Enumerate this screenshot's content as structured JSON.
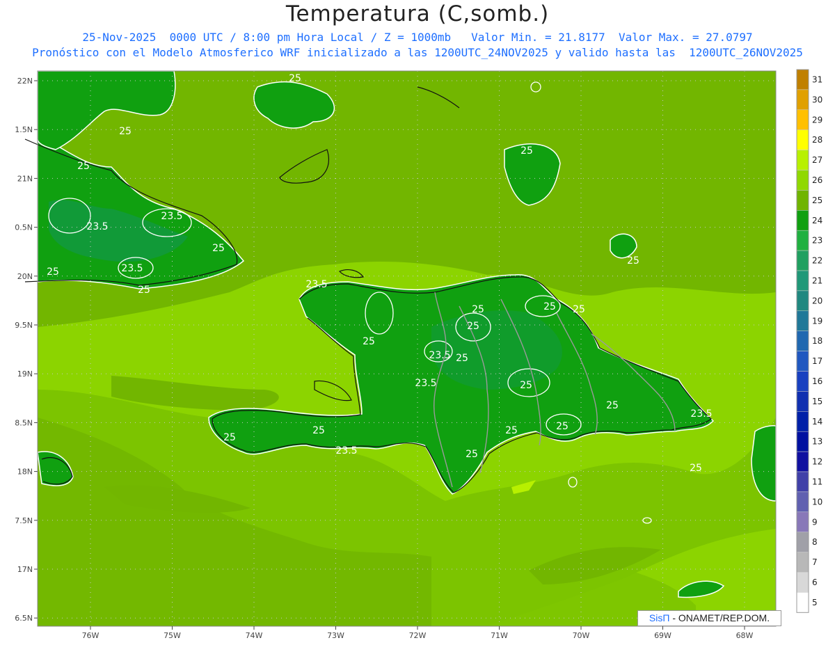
{
  "title": "Temperatura (C,somb.)",
  "subtitle_line1": "25-Nov-2025  0000 UTC / 8:00 pm Hora Local / Z = 1000mb   Valor Min. = 21.8177  Valor Max. = 27.0797",
  "subtitle_line2": "Pronóstico con el Modelo Atmosferico WRF inicializado a las 1200UTC_24NOV2025 y valido hasta las  1200UTC_26NOV2025",
  "y_ticks": [
    "22N",
    "1.5N",
    "21N",
    "0.5N",
    "20N",
    "9.5N",
    "19N",
    "8.5N",
    "18N",
    "7.5N",
    "17N",
    "6.5N"
  ],
  "x_ticks": [
    "76W",
    "75W",
    "74W",
    "73W",
    "72W",
    "71W",
    "70W",
    "69W",
    "68W"
  ],
  "contour_labels": [
    "25",
    "25",
    "25",
    "25",
    "23.5",
    "23.5",
    "25",
    "23.5",
    "25",
    "23.5",
    "25",
    "25",
    "25",
    "25",
    "23.5",
    "25",
    "25",
    "23.5",
    "25",
    "25",
    "25",
    "23.5",
    "25",
    "25",
    "25",
    "23.5",
    "25",
    "25",
    "25",
    "25"
  ],
  "colorbar": {
    "labels": [
      "31",
      "30",
      "29",
      "28",
      "27",
      "26",
      "25",
      "24",
      "23",
      "22",
      "21",
      "20",
      "19",
      "18",
      "17",
      "16",
      "15",
      "14",
      "13",
      "12",
      "11",
      "10",
      "9",
      "8",
      "7",
      "6",
      "5"
    ],
    "colors": [
      "#c08000",
      "#e0a000",
      "#ffc000",
      "#ffff00",
      "#b8f000",
      "#90d800",
      "#70b400",
      "#10a010",
      "#20b040",
      "#20a060",
      "#209878",
      "#208880",
      "#207898",
      "#2068b0",
      "#2058c0",
      "#1840c0",
      "#1030b0",
      "#0020a8",
      "#0010a0",
      "#1010a0",
      "#4040a8",
      "#6060b0",
      "#8878b8",
      "#a0a0a8",
      "#b8b8b8",
      "#d8d8d8",
      "#ffffff"
    ]
  },
  "credit": {
    "sis": "SisΠ",
    "rest": " - ONAMET/REP.DOM."
  },
  "colors": {
    "field_light": "#8cd400",
    "field_mid": "#72b600",
    "field_dark_green": "#20a020",
    "field_deep": "#119a38",
    "title_blue": "#1e6fff"
  }
}
